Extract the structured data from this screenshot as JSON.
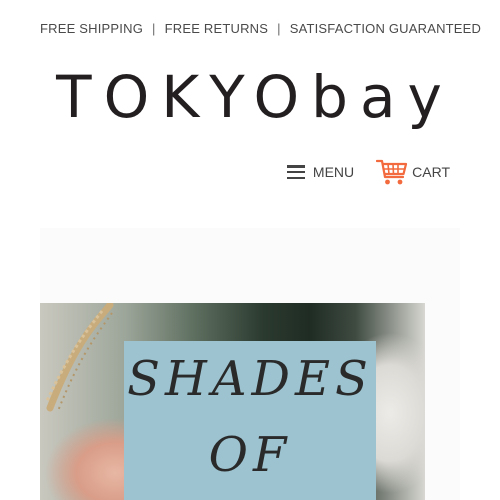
{
  "promo": {
    "items": [
      "FREE SHIPPING",
      "FREE RETURNS",
      "SATISFACTION GUARANTEED"
    ],
    "separator": "|"
  },
  "logo": {
    "text": "TOKYObay"
  },
  "nav": {
    "menu_label": "MENU",
    "menu_icon": "hamburger-icon",
    "cart_label": "CART",
    "cart_icon": "shopping-cart-icon",
    "accent_color": "#f26a3d"
  },
  "hero": {
    "title_lines": [
      "SHADES",
      "OF"
    ],
    "card_color": "#9cc3cf"
  }
}
